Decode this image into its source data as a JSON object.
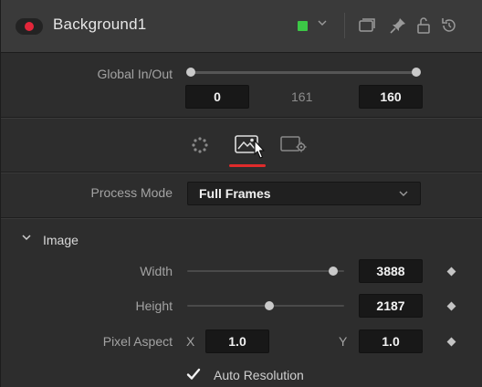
{
  "header": {
    "title": "Background1",
    "enabled_color": "#e3263a",
    "color_tag": "#3cc846",
    "icons": [
      "minimize-icon",
      "pin-icon",
      "lock-icon",
      "reset-icon"
    ]
  },
  "global_in_out": {
    "label": "Global In/Out",
    "in_value": "0",
    "mid_value": "161",
    "out_value": "160"
  },
  "tabs": [
    {
      "name": "controls-tab",
      "icon": "dotted-circle-icon",
      "active": false
    },
    {
      "name": "image-tab",
      "icon": "image-icon",
      "active": true
    },
    {
      "name": "settings-tab",
      "icon": "frame-gear-icon",
      "active": false
    }
  ],
  "process_mode": {
    "label": "Process Mode",
    "value": "Full Frames"
  },
  "image_section": {
    "title": "Image",
    "width": {
      "label": "Width",
      "value": "3888",
      "fraction": 0.96
    },
    "height": {
      "label": "Height",
      "value": "2187",
      "fraction": 0.54
    },
    "pixel_aspect": {
      "label": "Pixel Aspect",
      "x_label": "X",
      "x_value": "1.0",
      "y_label": "Y",
      "y_value": "1.0"
    },
    "auto_resolution": {
      "label": "Auto Resolution",
      "checked": true
    }
  }
}
